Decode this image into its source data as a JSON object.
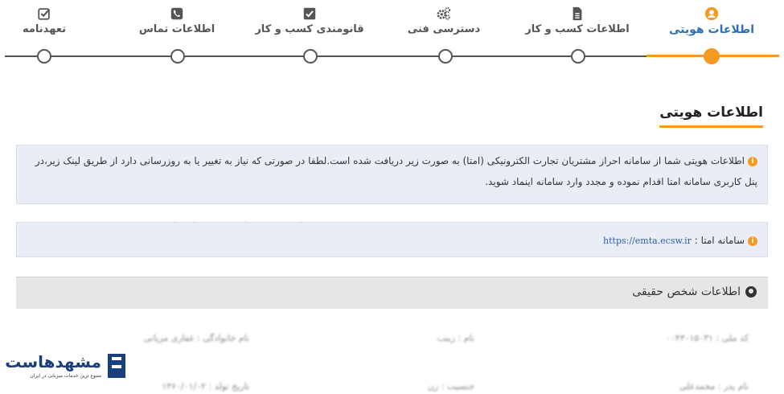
{
  "stepper": {
    "steps": [
      {
        "label": "اطلاعات هویتی",
        "icon": "user-circle-icon",
        "active": true
      },
      {
        "label": "اطلاعات کسب و کار",
        "icon": "document-icon",
        "active": false
      },
      {
        "label": "دسترسی فنی",
        "icon": "gears-icon",
        "active": false
      },
      {
        "label": "قانومندی کسب و کار",
        "icon": "check-square-icon",
        "active": false
      },
      {
        "label": "اطلاعات تماس",
        "icon": "phone-icon",
        "active": false
      },
      {
        "label": "تعهدنامه",
        "icon": "check-square-outline-icon",
        "active": false
      }
    ],
    "colors": {
      "active": "#f59a23",
      "inactive": "#555555",
      "active_label": "#2f6fb3"
    }
  },
  "main": {
    "section_title": "اطلاعات هویتی",
    "notice_text": "اطلاعات هویتی شما از سامانه احراز مشتریان تجارت الکترونیکی (امتا) به صورت زیر دریافت شده است.لطفا در صورتی که نیاز به تغییر یا به روزرسانی دارد از طریق لینک زیر،در پنل کاربری سامانه امتا اقدام نموده و مجدد وارد سامانه اینماد شوید.",
    "emta_label": "سامانه امتا :",
    "emta_link": "https://emta.ecsw.ir",
    "person_panel_title": "اطلاعات شخص حقیقی",
    "fields": [
      {
        "label": "کد ملی :",
        "value": "۰۰۴۳۰۱۵۰۳۱"
      },
      {
        "label": "نام :",
        "value": "زینب"
      },
      {
        "label": "نام خانوادگی :",
        "value": "غفاری مزیانی"
      },
      {
        "label": "نام پدر :",
        "value": "محمدعلی"
      },
      {
        "label": "جنسیت :",
        "value": "زن"
      },
      {
        "label": "تاریخ تولد :",
        "value": "۱۳۶۰/۰۱/۰۲"
      }
    ]
  },
  "watermark": {
    "name": "مشهدهاست",
    "tagline": "متنوع ترین خدمات میزبانی در ایران"
  },
  "logo": {
    "name": "مشهدهاست",
    "tagline": "متنوع ترین خدمات میزبانی در ایران"
  }
}
